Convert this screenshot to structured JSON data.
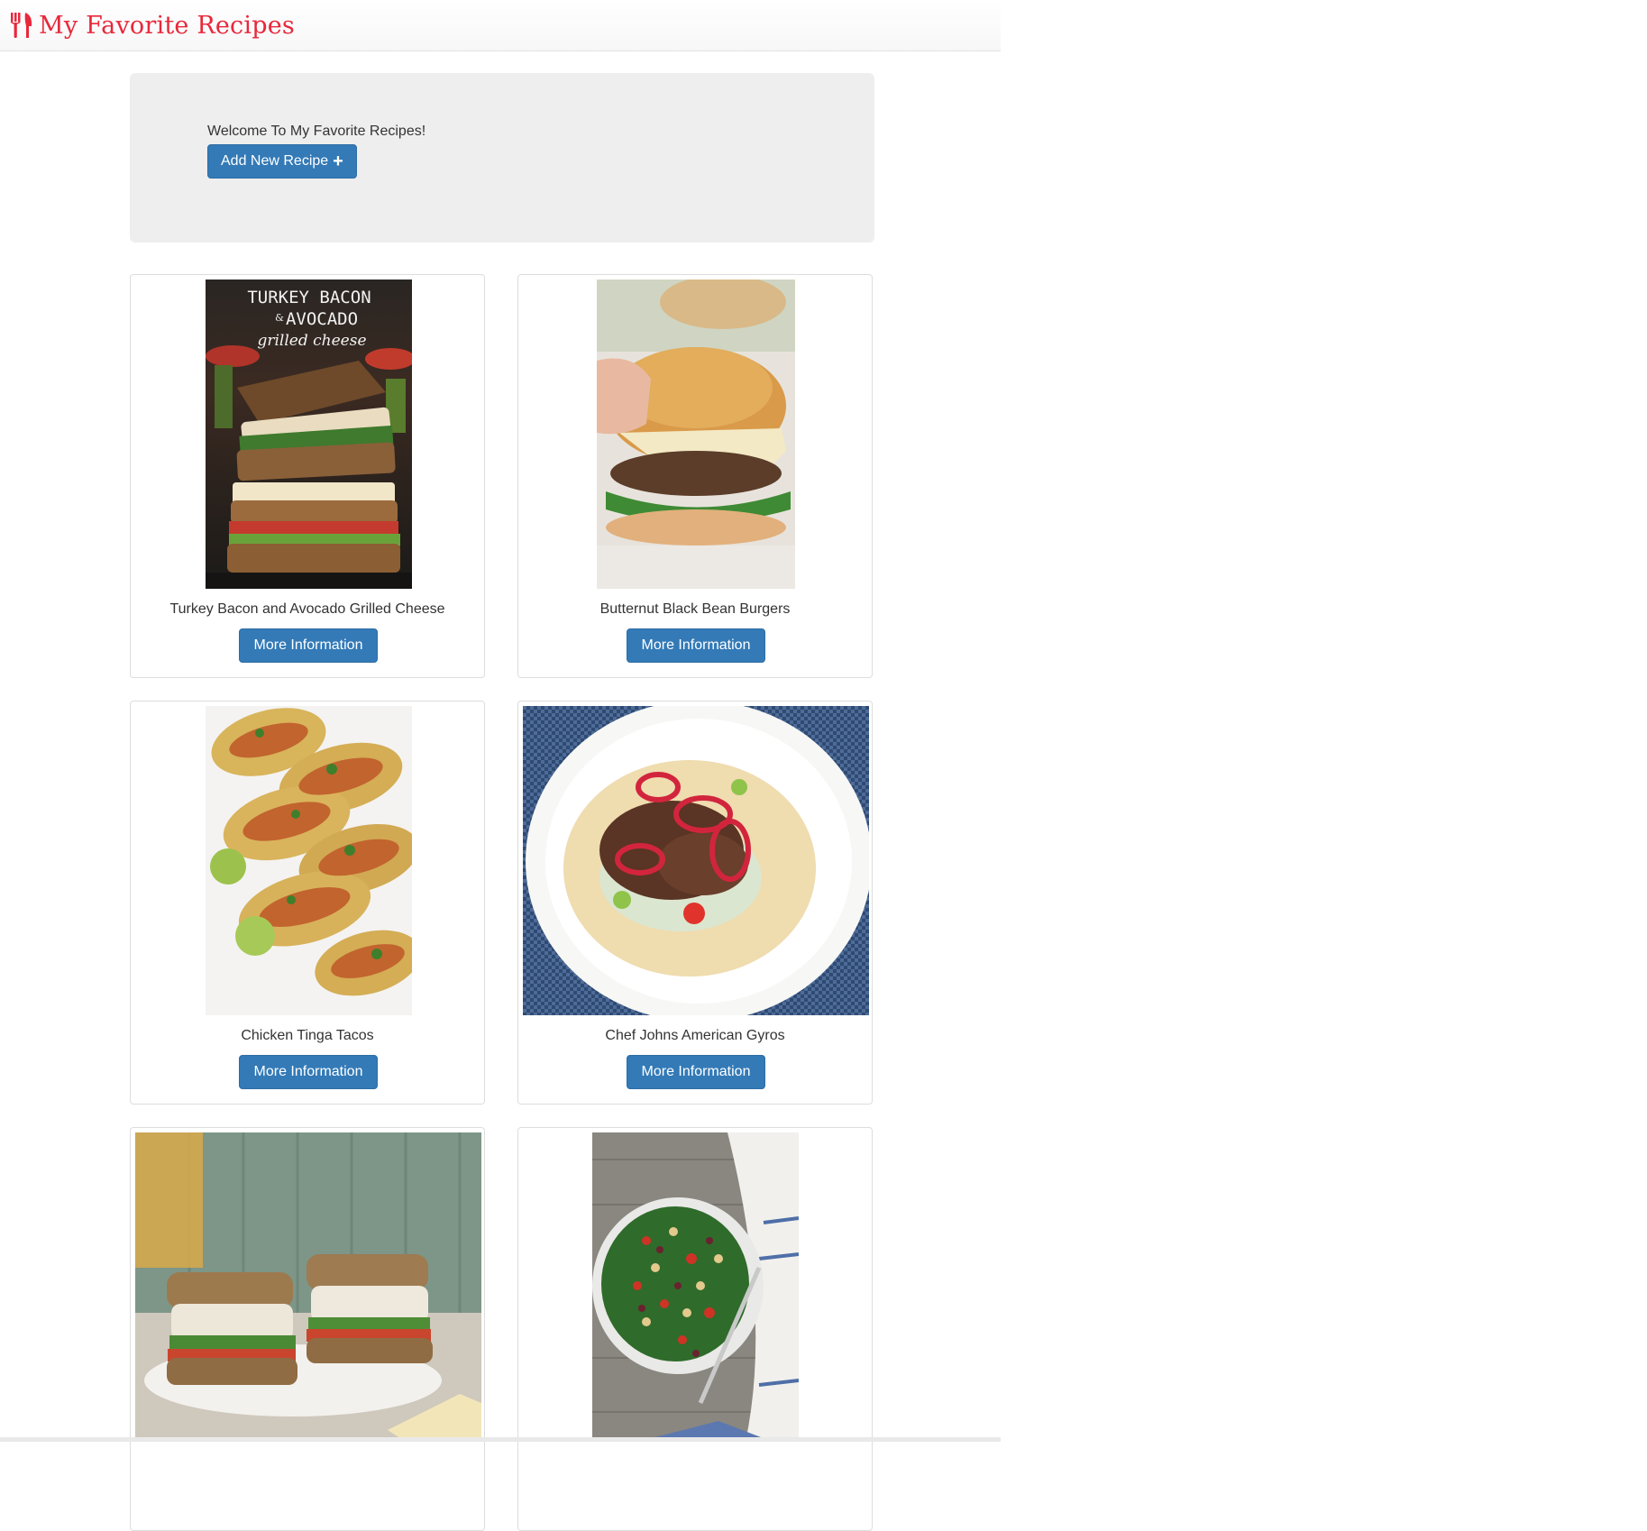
{
  "brand": {
    "title": "My Favorite Recipes",
    "icon": "utensils-icon",
    "color": "#e8283b"
  },
  "jumbotron": {
    "welcome_text": "Welcome To My Favorite Recipes!",
    "add_button_label": "Add New Recipe",
    "add_button_icon": "plus-icon"
  },
  "colors": {
    "primary": "#337ab7",
    "jumbotron_bg": "#eeeeee",
    "brand": "#e8283b"
  },
  "recipes": [
    {
      "title": "Turkey Bacon and Avocado Grilled Cheese",
      "button_label": "More Information",
      "image_text": [
        "TURKEY BACON",
        "&",
        "AVOCADO",
        "grilled cheese"
      ]
    },
    {
      "title": "Butternut Black Bean Burgers",
      "button_label": "More Information"
    },
    {
      "title": "Chicken Tinga Tacos",
      "button_label": "More Information"
    },
    {
      "title": "Chef Johns American Gyros",
      "button_label": "More Information"
    },
    {
      "title": "",
      "button_label": ""
    },
    {
      "title": "",
      "button_label": ""
    }
  ]
}
